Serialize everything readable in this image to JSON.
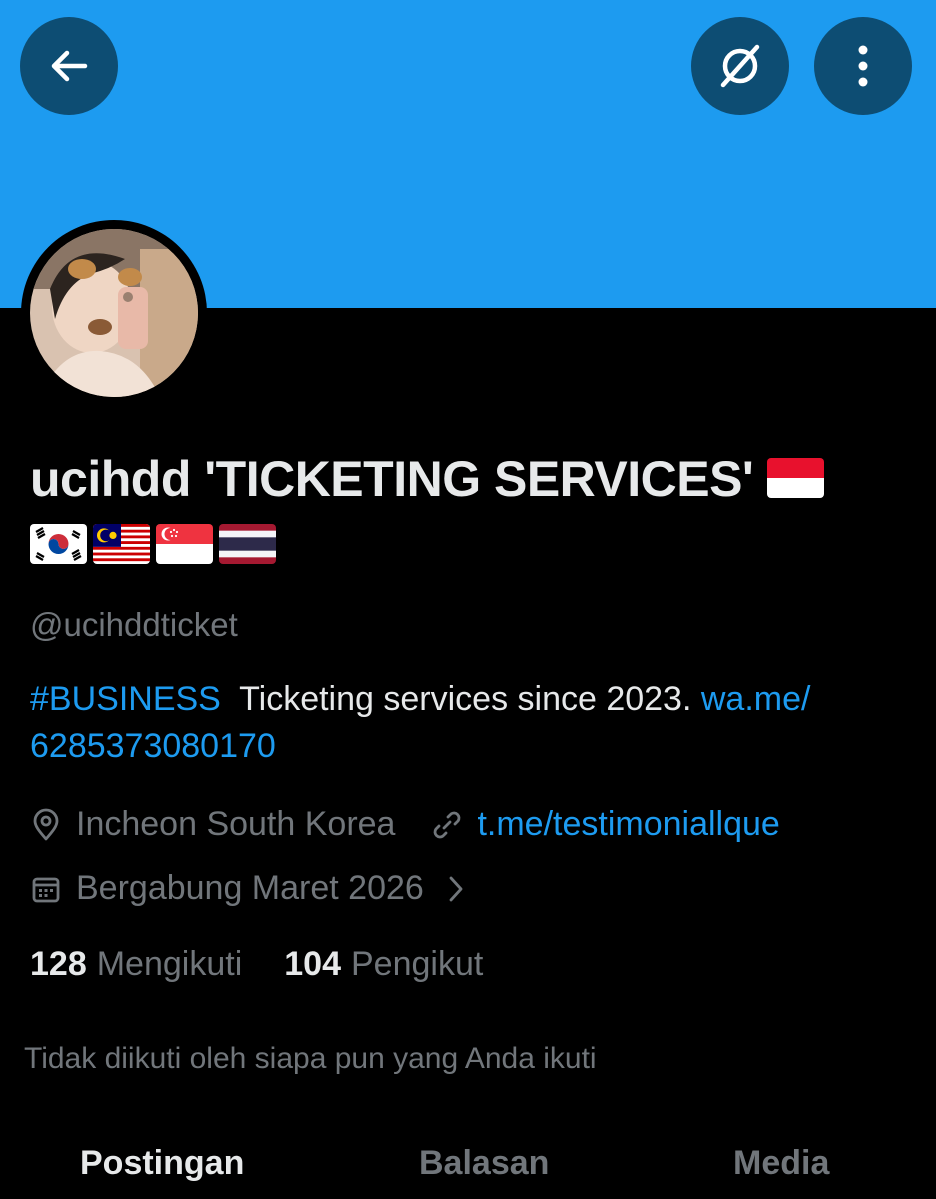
{
  "colors": {
    "banner": "#1d9bf0",
    "background": "#000000",
    "accent_link": "#1d9bf0",
    "secondary_text": "#71767b",
    "primary_text": "#e7e9ea"
  },
  "top_bar": {
    "back_icon": "arrow-left-icon",
    "grok_icon": "grok-slash-icon",
    "more_icon": "vertical-dots-icon"
  },
  "profile": {
    "display_name": "ucihdd 'TICKETING SERVICES'",
    "flags": [
      "indonesia-flag",
      "south-korea-flag",
      "malaysia-flag",
      "singapore-flag",
      "thailand-flag"
    ],
    "handle": "@ucihddticket",
    "bio": {
      "hashtag": "#BUSINESS",
      "text": "Ticketing services since 2023.",
      "link_part1": "wa.me/",
      "link_part2": "6285373080170"
    },
    "location": "Incheon South Korea",
    "website": "t.me/testimoniallque",
    "joined": "Bergabung Maret 2026"
  },
  "stats": {
    "following_count": "128",
    "following_label": "Mengikuti",
    "followers_count": "104",
    "followers_label": "Pengikut"
  },
  "followed_by_text": "Tidak diikuti oleh siapa pun yang Anda ikuti",
  "tabs": [
    {
      "label": "Postingan",
      "active": true
    },
    {
      "label": "Balasan",
      "active": false
    },
    {
      "label": "Media",
      "active": false
    }
  ]
}
